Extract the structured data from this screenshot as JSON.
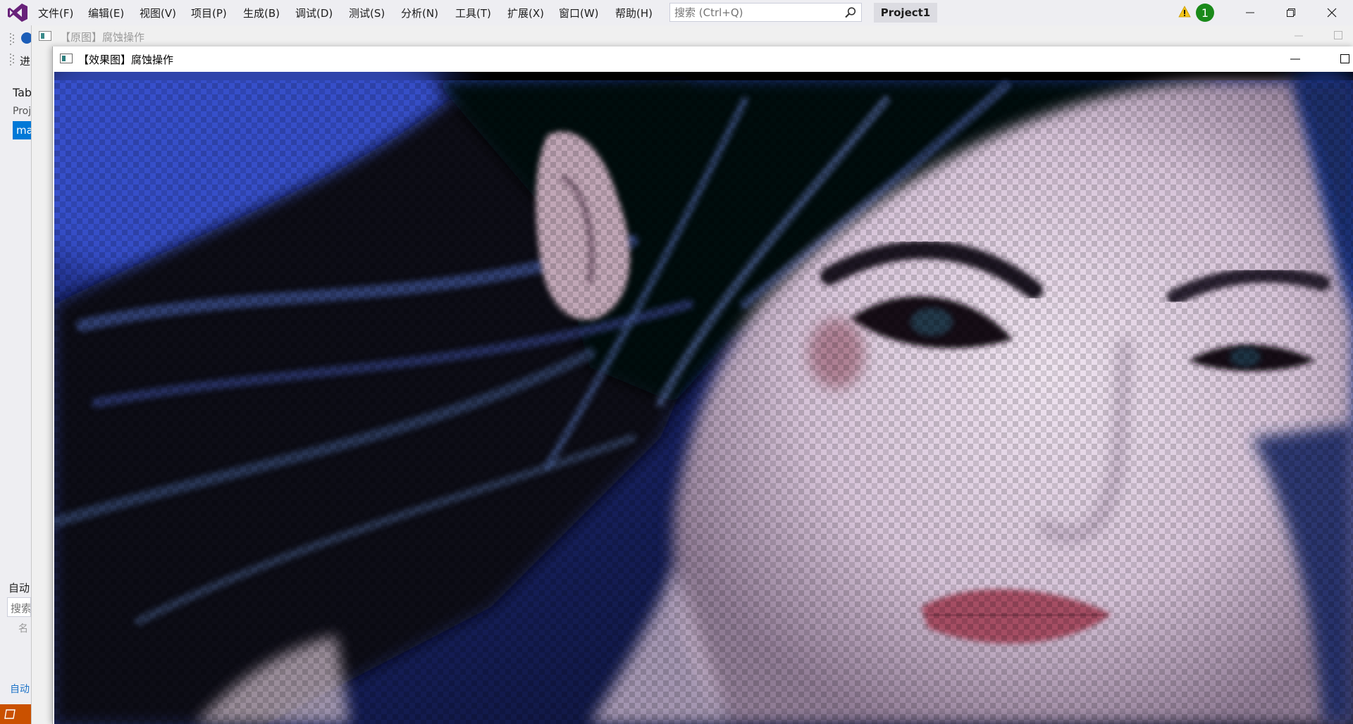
{
  "vs": {
    "menu": [
      {
        "name": "menu-file",
        "label": "文件(F)"
      },
      {
        "name": "menu-edit",
        "label": "编辑(E)"
      },
      {
        "name": "menu-view",
        "label": "视图(V)"
      },
      {
        "name": "menu-project",
        "label": "项目(P)"
      },
      {
        "name": "menu-build",
        "label": "生成(B)"
      },
      {
        "name": "menu-debug",
        "label": "调试(D)"
      },
      {
        "name": "menu-test",
        "label": "测试(S)"
      },
      {
        "name": "menu-analyze",
        "label": "分析(N)"
      },
      {
        "name": "menu-tools",
        "label": "工具(T)"
      },
      {
        "name": "menu-extensions",
        "label": "扩展(X)"
      },
      {
        "name": "menu-window",
        "label": "窗口(W)"
      },
      {
        "name": "menu-help",
        "label": "帮助(H)"
      }
    ],
    "search_placeholder": "搜索 (Ctrl+Q)",
    "project_name": "Project1",
    "notification_count": "1",
    "left_panel": {
      "progress_label": "进",
      "tab_label": "Tab",
      "project_label": "Proj",
      "selected_item": "ma",
      "auto_label": "自动",
      "search_label": "搜索",
      "name_column": "名",
      "auto_link": "自动"
    }
  },
  "windows": {
    "original_title": "【原图】腐蚀操作",
    "effect_title": "【效果图】腐蚀操作"
  },
  "colors": {
    "vs_accent": "#68217a",
    "selection": "#0078d7",
    "status_bar": "#ca5100",
    "badge": "#1a8a1a"
  }
}
